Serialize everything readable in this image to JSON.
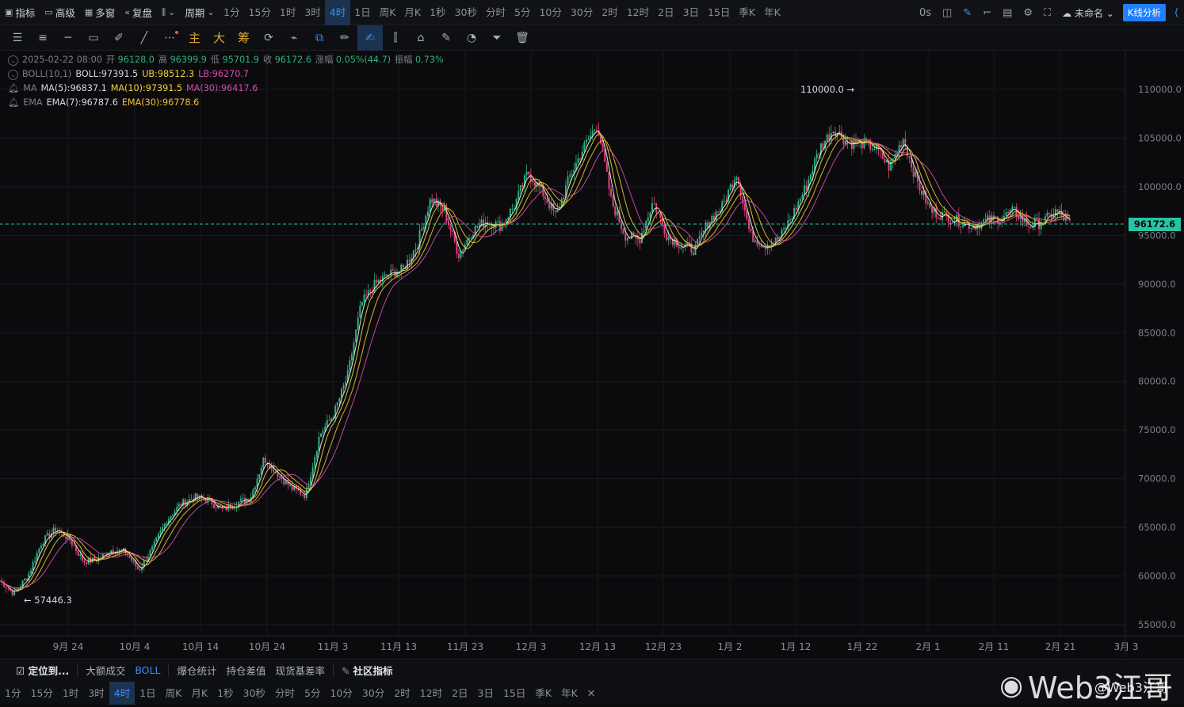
{
  "topbar": {
    "indicator": "指标",
    "advanced": "高级",
    "multiwindow": "多窗",
    "replay": "复盘",
    "period_label": "周期",
    "periods": [
      "1分",
      "15分",
      "1时",
      "3时",
      "4时",
      "1日",
      "周K",
      "月K",
      "1秒",
      "30秒",
      "分时",
      "5分",
      "10分",
      "30分",
      "2时",
      "12时",
      "2日",
      "3日",
      "15日",
      "季K",
      "年K"
    ],
    "active_period": "4时",
    "latency": "0s",
    "layout_name": "未命名",
    "k_analysis": "K线分析"
  },
  "toolbar": {
    "cjk_tools": [
      "主",
      "大",
      "筹"
    ]
  },
  "legend": {
    "date": "2025-02-22 08:00",
    "open_label": "开",
    "open": "96128.0",
    "high_label": "高",
    "high": "96399.9",
    "low_label": "低",
    "low": "95701.9",
    "close_label": "收",
    "close": "96172.6",
    "change_label": "涨幅",
    "change": "0.05%(44.7)",
    "amp_label": "振幅",
    "amp": "0.73%",
    "boll_name": "BOLL(10,1)",
    "boll": "BOLL:97391.5",
    "ub": "UB:98512.3",
    "lb": "LB:96270.7",
    "ma_name": "MA",
    "ma5": "MA(5):96837.1",
    "ma10": "MA(10):97391.5",
    "ma30": "MA(30):96417.6",
    "ema_name": "EMA",
    "ema7": "EMA(7):96787.6",
    "ema30": "EMA(30):96778.6"
  },
  "chart_data": {
    "type": "candlestick",
    "symbol_interval": "4时",
    "ylim": [
      55000,
      112000
    ],
    "y_ticks": [
      "110000.0",
      "105000.0",
      "100000.0",
      "95000.0",
      "90000.0",
      "85000.0",
      "80000.0",
      "75000.0",
      "70000.0",
      "65000.0",
      "60000.0",
      "55000.0"
    ],
    "x_ticks": [
      "9月 24",
      "10月 4",
      "10月 14",
      "10月 24",
      "11月 3",
      "11月 13",
      "11月 23",
      "12月 3",
      "12月 13",
      "12月 23",
      "1月 2",
      "1月 12",
      "1月 22",
      "2月 1",
      "2月 11",
      "2月 21",
      "3月 3"
    ],
    "last_price": "96172.6",
    "high_marker": "110000.0",
    "low_marker": "57446.3",
    "series": [
      {
        "x": "9月 19",
        "y": 59500
      },
      {
        "x": "9月 21",
        "y": 58200
      },
      {
        "x": "9月 23",
        "y": 60000
      },
      {
        "x": "9月 26",
        "y": 63500
      },
      {
        "x": "9月 28",
        "y": 64800
      },
      {
        "x": "9月 30",
        "y": 63800
      },
      {
        "x": "10月 2",
        "y": 61500
      },
      {
        "x": "10月 4",
        "y": 61700
      },
      {
        "x": "10月 6",
        "y": 62700
      },
      {
        "x": "10月 8",
        "y": 62500
      },
      {
        "x": "10月 10",
        "y": 60600
      },
      {
        "x": "10月 12",
        "y": 62900
      },
      {
        "x": "10月 14",
        "y": 65800
      },
      {
        "x": "10月 16",
        "y": 67400
      },
      {
        "x": "10月 18",
        "y": 68100
      },
      {
        "x": "10月 21",
        "y": 67800
      },
      {
        "x": "10月 23",
        "y": 66800
      },
      {
        "x": "10月 25",
        "y": 67500
      },
      {
        "x": "10月 27",
        "y": 68000
      },
      {
        "x": "10月 29",
        "y": 72100
      },
      {
        "x": "10月 31",
        "y": 70500
      },
      {
        "x": "11月 2",
        "y": 69000
      },
      {
        "x": "11月 4",
        "y": 68300
      },
      {
        "x": "11月 6",
        "y": 74500
      },
      {
        "x": "11月 8",
        "y": 76600
      },
      {
        "x": "11月 10",
        "y": 80500
      },
      {
        "x": "11月 12",
        "y": 88000
      },
      {
        "x": "11月 14",
        "y": 90000
      },
      {
        "x": "11月 16",
        "y": 91000
      },
      {
        "x": "11月 18",
        "y": 91500
      },
      {
        "x": "11月 20",
        "y": 94000
      },
      {
        "x": "11月 22",
        "y": 98800
      },
      {
        "x": "11月 24",
        "y": 97500
      },
      {
        "x": "11月 26",
        "y": 93000
      },
      {
        "x": "11月 28",
        "y": 95500
      },
      {
        "x": "11月 30",
        "y": 96500
      },
      {
        "x": "12月 2",
        "y": 96000
      },
      {
        "x": "12月 4",
        "y": 98000
      },
      {
        "x": "12月 6",
        "y": 101500
      },
      {
        "x": "12月 8",
        "y": 99500
      },
      {
        "x": "12月 10",
        "y": 97000
      },
      {
        "x": "12月 12",
        "y": 101000
      },
      {
        "x": "12月 15",
        "y": 104000
      },
      {
        "x": "12月 17",
        "y": 106500
      },
      {
        "x": "12月 19",
        "y": 98500
      },
      {
        "x": "12月 21",
        "y": 95000
      },
      {
        "x": "12月 23",
        "y": 94500
      },
      {
        "x": "12月 25",
        "y": 98500
      },
      {
        "x": "12月 27",
        "y": 95000
      },
      {
        "x": "12月 29",
        "y": 94000
      },
      {
        "x": "12月 31",
        "y": 93500
      },
      {
        "x": "1月 2",
        "y": 96500
      },
      {
        "x": "1月 4",
        "y": 98000
      },
      {
        "x": "1月 6",
        "y": 101500
      },
      {
        "x": "1月 8",
        "y": 95000
      },
      {
        "x": "1月 10",
        "y": 94000
      },
      {
        "x": "1月 12",
        "y": 94500
      },
      {
        "x": "1月 14",
        "y": 97000
      },
      {
        "x": "1月 16",
        "y": 100000
      },
      {
        "x": "1月 18",
        "y": 104000
      },
      {
        "x": "1月 20",
        "y": 106000
      },
      {
        "x": "1月 22",
        "y": 104500
      },
      {
        "x": "1月 24",
        "y": 104500
      },
      {
        "x": "1月 26",
        "y": 104000
      },
      {
        "x": "1月 28",
        "y": 102000
      },
      {
        "x": "1月 30",
        "y": 105000
      },
      {
        "x": "2月 1",
        "y": 100500
      },
      {
        "x": "2月 3",
        "y": 97500
      },
      {
        "x": "2月 5",
        "y": 97000
      },
      {
        "x": "2月 7",
        "y": 96500
      },
      {
        "x": "2月 9",
        "y": 96000
      },
      {
        "x": "2月 11",
        "y": 96500
      },
      {
        "x": "2月 13",
        "y": 96800
      },
      {
        "x": "2月 15",
        "y": 97500
      },
      {
        "x": "2月 17",
        "y": 96000
      },
      {
        "x": "2月 19",
        "y": 96300
      },
      {
        "x": "2月 21",
        "y": 97500
      },
      {
        "x": "2月 22",
        "y": 96172
      }
    ]
  },
  "bottombar": {
    "locate": "定位到...",
    "big_trades": "大额成交",
    "boll": "BOLL",
    "liq_stats": "爆仓统计",
    "oi_diff": "持仓差值",
    "basis": "现货基差率",
    "community": "社区指标",
    "periods": [
      "1分",
      "15分",
      "1时",
      "3时",
      "4时",
      "1日",
      "周K",
      "月K",
      "1秒",
      "30秒",
      "分时",
      "5分",
      "10分",
      "30分",
      "2时",
      "12时",
      "2日",
      "3日",
      "15日",
      "季K",
      "年K"
    ],
    "active_period": "4时"
  },
  "watermark": {
    "text": "Web3江哥",
    "handle": "@Web3江哥"
  },
  "colors": {
    "up": "#2fb27f",
    "down": "#e0457a",
    "ma5": "#f5f5f5",
    "ma10": "#f3d23a",
    "ma30": "#d74bb0",
    "accent": "#3d8dff",
    "last_price": "#27c4a4"
  }
}
